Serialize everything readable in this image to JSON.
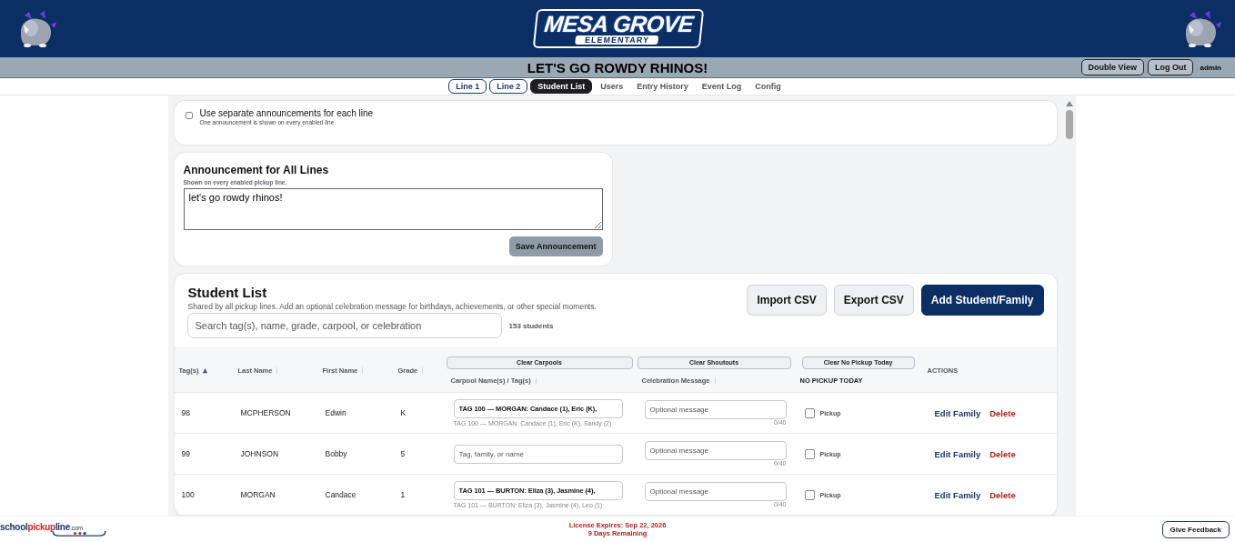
{
  "header": {
    "logo_main": "MESA GROVE",
    "logo_sub": "ELEMENTARY"
  },
  "banner": {
    "title": "LET'S GO ROWDY RHINOS!",
    "buttons": [
      "Double View",
      "Log Out"
    ],
    "user": "admin"
  },
  "tabs": [
    {
      "label": "Line 1",
      "kind": "outlined",
      "selected": false
    },
    {
      "label": "Line 2",
      "kind": "outlined",
      "selected": false
    },
    {
      "label": "Student List",
      "kind": "outlined",
      "selected": true
    },
    {
      "label": "Users",
      "kind": "plain",
      "selected": false
    },
    {
      "label": "Entry History",
      "kind": "plain",
      "selected": false
    },
    {
      "label": "Event Log",
      "kind": "plain",
      "selected": false
    },
    {
      "label": "Config",
      "kind": "plain",
      "selected": false
    }
  ],
  "separate_announcements": {
    "label": "Use separate announcements for each line",
    "hint": "One announcement is shown on every enabled line.",
    "checked": false
  },
  "announcement": {
    "title": "Announcement for All Lines",
    "hint": "Shown on every enabled pickup line.",
    "value": "let's go rowdy rhinos!",
    "button": "Save Announcement"
  },
  "student_list": {
    "title": "Student List",
    "description": "Shared by all pickup lines. Add an optional celebration message for birthdays, achievements, or other special moments.",
    "buttons": [
      {
        "label": "Import CSV",
        "kind": "secondary"
      },
      {
        "label": "Export CSV",
        "kind": "secondary"
      },
      {
        "label": "Add Student/Family",
        "kind": "primary"
      }
    ],
    "search": {
      "placeholder": "Search tag(s), name, grade, carpool, or celebration"
    },
    "count": "153 students",
    "columns": [
      {
        "label": "Tag(s)",
        "sorted": true
      },
      {
        "label": "Last Name",
        "sorted": false
      },
      {
        "label": "First Name",
        "sorted": false
      },
      {
        "label": "Grade",
        "sorted": false
      },
      {
        "label": "Carpool Name(s) / Tag(s)",
        "sorted": false,
        "clear_button": "Clear Carpools"
      },
      {
        "label": "Celebration Message",
        "sorted": false,
        "clear_button": "Clear Shoutouts"
      },
      {
        "label": "NO PICKUP TODAY",
        "clear_button": "Clear No Pickup Today"
      },
      {
        "label": "ACTIONS"
      }
    ],
    "rows": [
      {
        "tag": "98",
        "last_name": "MCPHERSON",
        "first_name": "Edwin",
        "grade": "K",
        "carpool": {
          "value": "TAG 100 — MORGAN: Candace (1), Eric (K),",
          "hint": "TAG 100 — MORGAN: Candace (1), Eric (K), Sandy (2)"
        },
        "celebration": {
          "placeholder": "Optional message",
          "counter": "0/40"
        },
        "no_pickup": {
          "label": "Pickup",
          "checked": false
        },
        "actions": [
          "Edit Family",
          "Delete"
        ]
      },
      {
        "tag": "99",
        "last_name": "JOHNSON",
        "first_name": "Bobby",
        "grade": "5",
        "carpool": {
          "placeholder": "Tag, family, or name"
        },
        "celebration": {
          "placeholder": "Optional message",
          "counter": "0/40"
        },
        "no_pickup": {
          "label": "Pickup",
          "checked": false
        },
        "actions": [
          "Edit Family",
          "Delete"
        ]
      },
      {
        "tag": "100",
        "last_name": "MORGAN",
        "first_name": "Candace",
        "grade": "1",
        "carpool": {
          "value": "TAG 101 — BURTON: Eliza (3), Jasmine (4),",
          "hint": "TAG 101 — BURTON: Eliza (3), Jasmine (4), Leo (1)"
        },
        "celebration": {
          "placeholder": "Optional message",
          "counter": "0/40"
        },
        "no_pickup": {
          "label": "Pickup",
          "checked": false
        },
        "actions": [
          "Edit Family",
          "Delete"
        ]
      }
    ]
  },
  "footer": {
    "brand": [
      {
        "text": "school",
        "kind": "dark"
      },
      {
        "text": "pickup",
        "kind": "red"
      },
      {
        "text": "line",
        "kind": "dark"
      },
      {
        "text": ".com",
        "kind": "small"
      }
    ],
    "license": [
      "License Expires: Sep 22, 2026",
      "9 Days Remaining"
    ],
    "feedback": "Give Feedback"
  }
}
